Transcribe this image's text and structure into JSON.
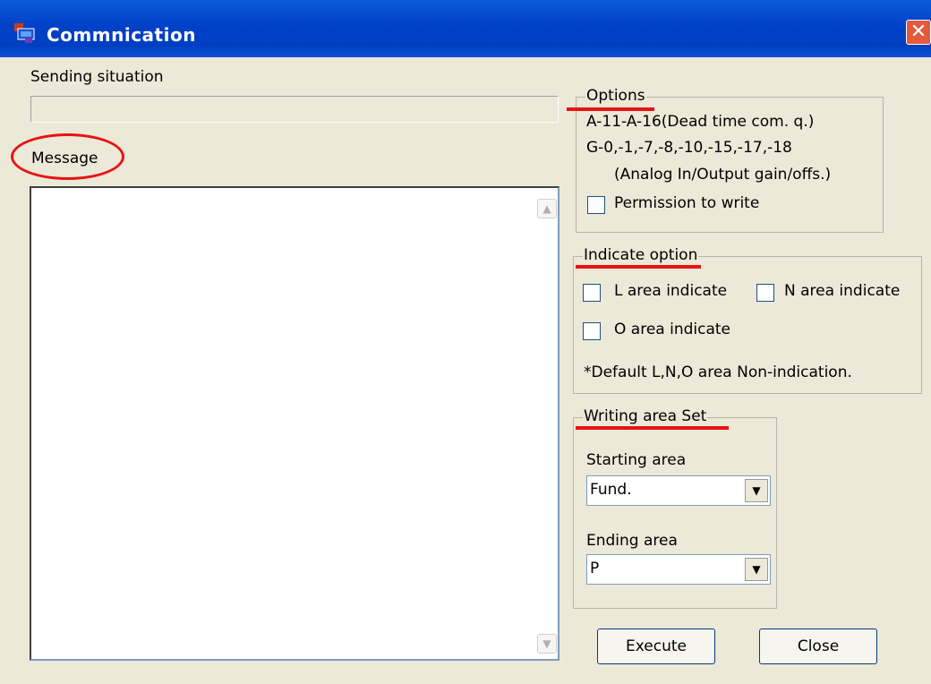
{
  "window": {
    "title": "Commnication",
    "close_glyph": "✕"
  },
  "sending": {
    "label": "Sending situation",
    "progress_fraction": 0
  },
  "message": {
    "label": "Message",
    "text": ""
  },
  "options": {
    "legend": "Options",
    "line1": "A-11-A-16(Dead time com. q.)",
    "line2": "G-0,-1,-7,-8,-10,-15,-17,-18",
    "line3": "(Analog In/Output gain/offs.)",
    "permission_label": "Permission to write",
    "permission_checked": false
  },
  "indicate": {
    "legend": "Indicate option",
    "l_label": "L area indicate",
    "n_label": "N area indicate",
    "o_label": "O area indicate",
    "note": "*Default L,N,O area Non-indication."
  },
  "writing": {
    "legend": "Writing area Set",
    "starting_label": "Starting area",
    "starting_value": "Fund.",
    "ending_label": "Ending area",
    "ending_value": "P"
  },
  "buttons": {
    "execute": "Execute",
    "close": "Close"
  },
  "icons": {
    "scroll_up": "▲",
    "scroll_down": "▼",
    "combo_arrow": "▼"
  },
  "colors": {
    "titlebar": "#0041c8",
    "annotation": "#e81313",
    "dialog_bg": "#ece9d8"
  }
}
